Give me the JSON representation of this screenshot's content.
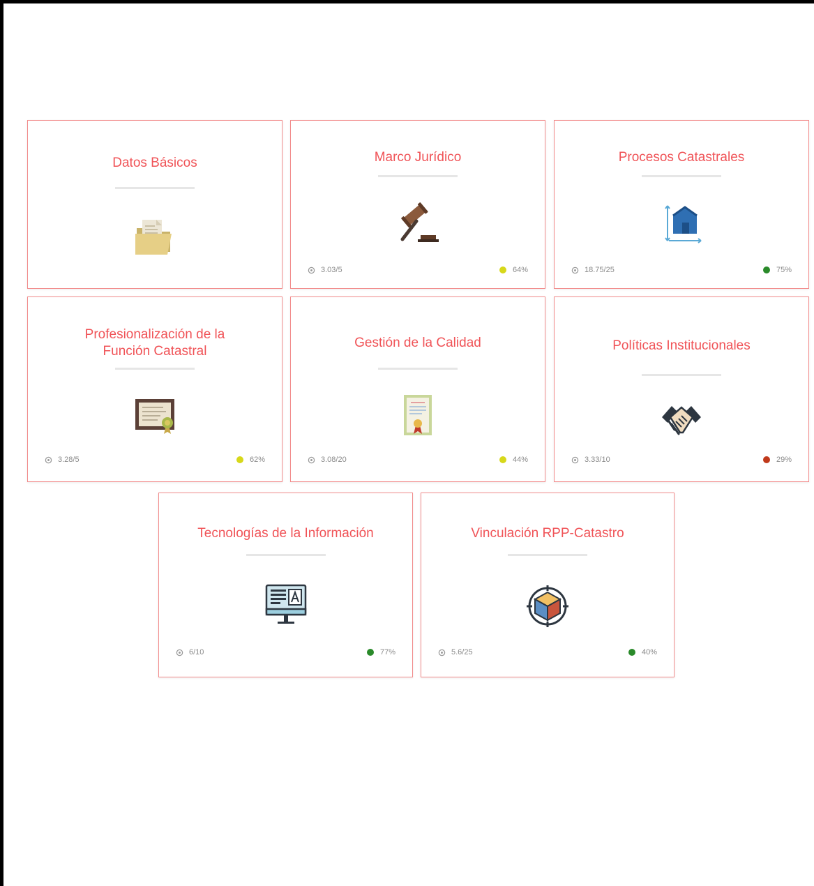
{
  "cards": [
    {
      "title": "Datos Básicos",
      "icon": "folder-icon",
      "score": "",
      "percent": "",
      "status_color": ""
    },
    {
      "title": "Marco Jurídico",
      "icon": "gavel-icon",
      "score": "3.03/5",
      "percent": "64%",
      "status_color": "#d7d81a"
    },
    {
      "title": "Procesos Catastrales",
      "icon": "house-blueprint-icon",
      "score": "18.75/25",
      "percent": "75%",
      "status_color": "#2a8a2a"
    },
    {
      "title": "Profesionalización de la\nFunción Catastral",
      "icon": "diploma-icon",
      "score": "3.28/5",
      "percent": "62%",
      "status_color": "#d7d81a"
    },
    {
      "title": "Gestión de la Calidad",
      "icon": "certificate-icon",
      "score": "3.08/20",
      "percent": "44%",
      "status_color": "#d7d81a"
    },
    {
      "title": "Políticas Institucionales",
      "icon": "handshake-icon",
      "score": "3.33/10",
      "percent": "29%",
      "status_color": "#c0391b"
    },
    {
      "title": "Tecnologías de la Información",
      "icon": "computer-monitor-icon",
      "score": "6/10",
      "percent": "77%",
      "status_color": "#2a8a2a"
    },
    {
      "title": "Vinculación RPP-Catastro",
      "icon": "cube-target-icon",
      "score": "5.6/25",
      "percent": "40%",
      "status_color": "#2a8a2a"
    }
  ]
}
